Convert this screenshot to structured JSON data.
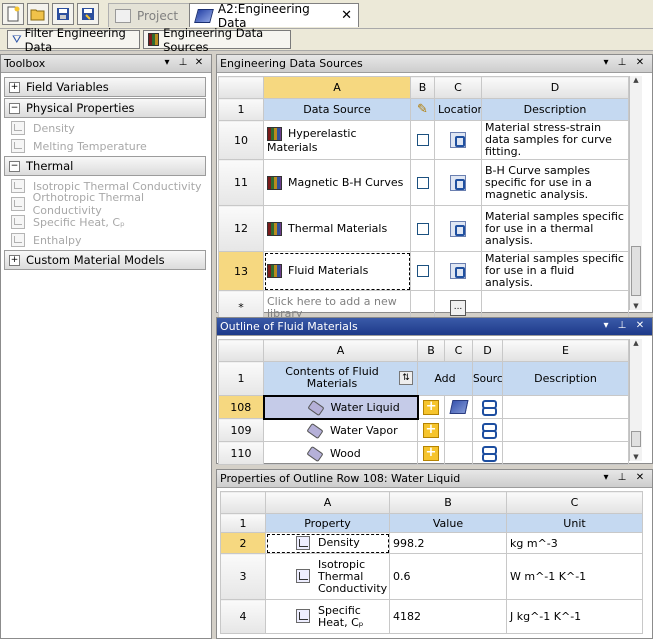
{
  "toolbar": {
    "project_tab": "Project",
    "active_tab": "A2:Engineering Data",
    "filter_button": "Filter Engineering Data",
    "sources_button": "Engineering Data Sources"
  },
  "toolbox": {
    "title": "Toolbox",
    "groups": [
      {
        "label": "Field Variables",
        "expanded": false
      },
      {
        "label": "Physical Properties",
        "expanded": true,
        "items": [
          "Density",
          "Melting Temperature"
        ]
      },
      {
        "label": "Thermal",
        "expanded": true,
        "items": [
          "Isotropic Thermal Conductivity",
          "Orthotropic Thermal Conductivity",
          "Specific Heat, Cₚ",
          "Enthalpy"
        ]
      },
      {
        "label": "Custom Material Models",
        "expanded": false
      }
    ]
  },
  "sources": {
    "title": "Engineering Data Sources",
    "col_letters": [
      "A",
      "B",
      "C",
      "D"
    ],
    "row_header": "1",
    "col_headers": [
      "Data Source",
      "",
      "Location",
      "Description"
    ],
    "rows": [
      {
        "num": "10",
        "name": "Hyperelastic Materials",
        "desc": "Material stress-strain data samples for curve fitting."
      },
      {
        "num": "11",
        "name": "Magnetic B-H Curves",
        "desc": "B-H Curve samples specific for use in a magnetic analysis."
      },
      {
        "num": "12",
        "name": "Thermal Materials",
        "desc": "Material samples specific for use in a thermal analysis."
      },
      {
        "num": "13",
        "name": "Fluid Materials",
        "desc": "Material samples specific for use in a fluid analysis."
      }
    ],
    "new_row_marker": "*",
    "new_row_text": "Click here to add a new library",
    "ellipsis": "..."
  },
  "outline": {
    "title": "Outline of Fluid Materials",
    "col_letters": [
      "A",
      "B",
      "C",
      "D",
      "E"
    ],
    "row_header": "1",
    "col_headers": [
      "Contents of Fluid Materials",
      "Add",
      "Source",
      "Description"
    ],
    "rows": [
      {
        "num": "108",
        "name": "Water Liquid"
      },
      {
        "num": "109",
        "name": "Water Vapor"
      },
      {
        "num": "110",
        "name": "Wood"
      }
    ]
  },
  "properties": {
    "title": "Properties of Outline Row 108: Water Liquid",
    "col_letters": [
      "A",
      "B",
      "C"
    ],
    "row_header": "1",
    "col_headers": [
      "Property",
      "Value",
      "Unit"
    ],
    "rows": [
      {
        "num": "2",
        "name": "Density",
        "value": "998.2",
        "unit": "kg m^-3"
      },
      {
        "num": "3",
        "name": "Isotropic Thermal Conductivity",
        "value": "0.6",
        "unit": "W m^-1 K^-1"
      },
      {
        "num": "4",
        "name": "Specific Heat, Cₚ",
        "value": "4182",
        "unit": "J kg^-1 K^-1"
      }
    ]
  },
  "panel_controls": {
    "dropdown": "▾",
    "pin": "⊥",
    "close": "✕"
  }
}
